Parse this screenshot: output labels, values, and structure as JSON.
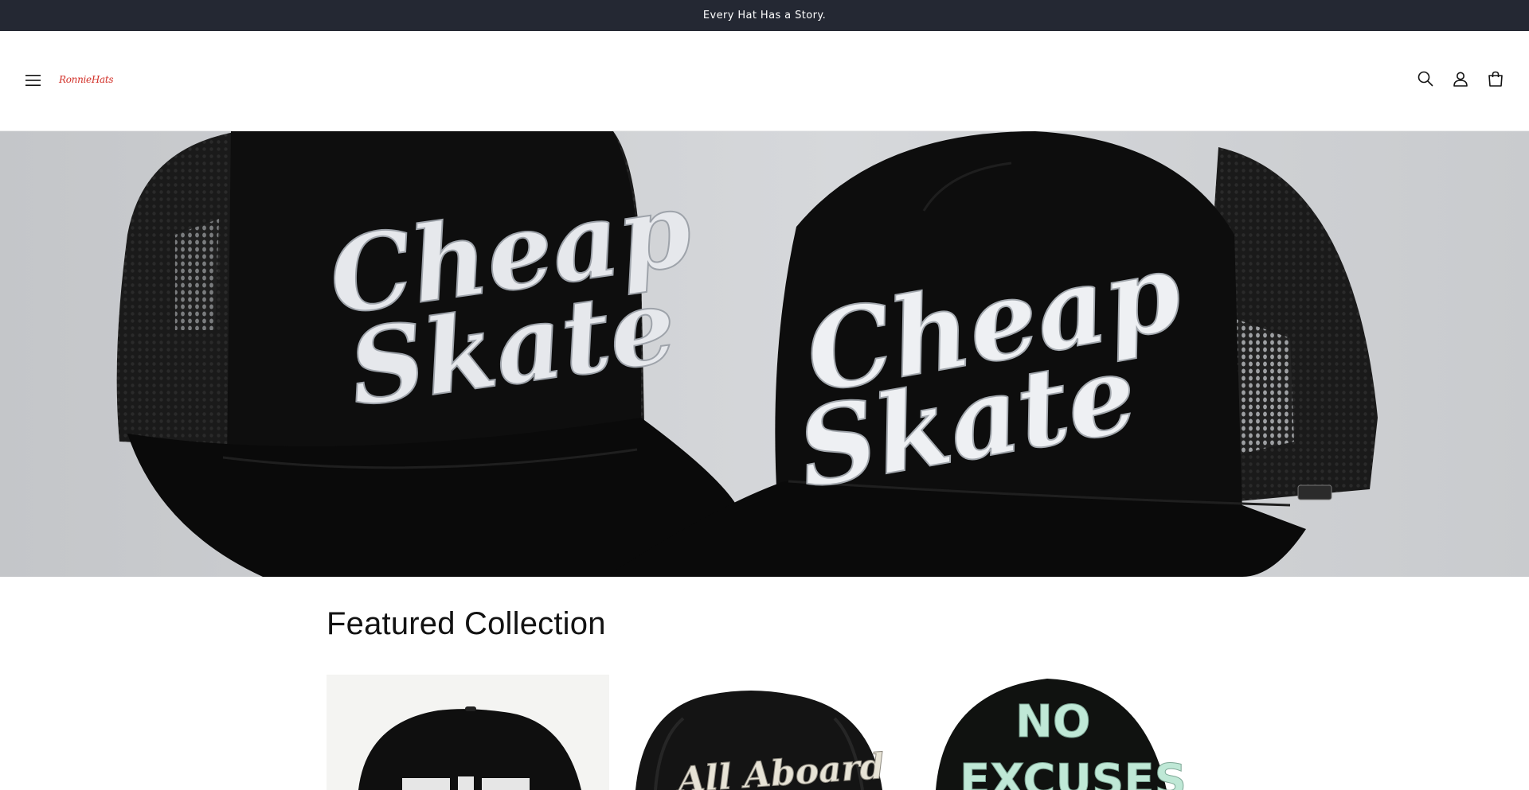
{
  "announcement": {
    "text": "Every Hat Has a Story."
  },
  "header": {
    "logo_text": "RonnieHats",
    "icons": [
      "menu-icon",
      "search-icon",
      "account-icon",
      "cart-icon"
    ]
  },
  "hero": {
    "image": "two-black-trucker-hats",
    "left_hat": {
      "line1": "Cheap",
      "line2": "Skate"
    },
    "right_hat": {
      "line1": "Cheap",
      "line2": "Skate"
    }
  },
  "featured": {
    "title": "Featured Collection",
    "products": [
      {
        "image_text": "FIGHT"
      },
      {
        "image_text": "All Aboard"
      },
      {
        "image_text_line1": "NO",
        "image_text_line2": "EXCUSES"
      }
    ]
  },
  "colors": {
    "announcement_bg": "#242833",
    "logo_red": "#d22f27",
    "hat_black": "#0c0c0c",
    "embroidery": "#e6e8ec",
    "mint_embroidery": "#bfe8d6"
  }
}
